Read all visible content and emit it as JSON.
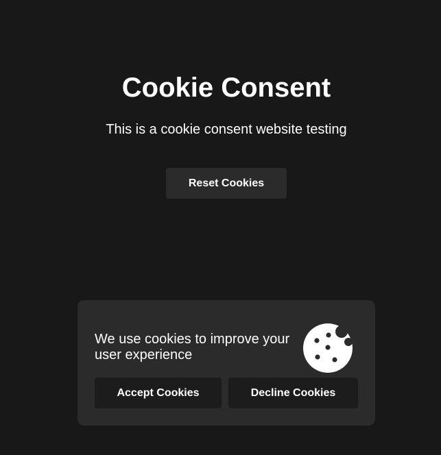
{
  "page": {
    "title": "Cookie Consent",
    "subtitle": "This is a cookie consent website testing",
    "reset_button_label": "Reset Cookies"
  },
  "cookie_banner": {
    "message": "We use cookies to improve your user experience",
    "icon": "cookie-icon",
    "accept_label": "Accept Cookies",
    "decline_label": "Decline Cookies"
  },
  "colors": {
    "background": "#181818",
    "surface": "#2b2b2b",
    "button_dark": "#1c1c1c",
    "text": "#ffffff"
  }
}
